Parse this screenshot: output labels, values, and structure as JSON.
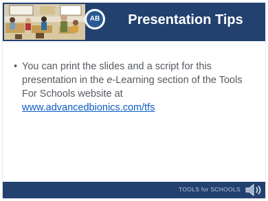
{
  "slide": {
    "title": "Presentation Tips",
    "logo_text": "AB",
    "bullet_intro": "You can print the slides and a script for this presentation in the ",
    "bullet_em": "e",
    "bullet_mid": "-Learning section of the Tools For Schools website at ",
    "bullet_link": "www.advancedbionics.com/tfs",
    "footer_text": "TOOLS for SCHOOLS",
    "audio_icon": "speaker-icon"
  },
  "colors": {
    "header_blue": "#22416f",
    "link_blue": "#0b5cc4",
    "text_gray": "#555a60"
  }
}
